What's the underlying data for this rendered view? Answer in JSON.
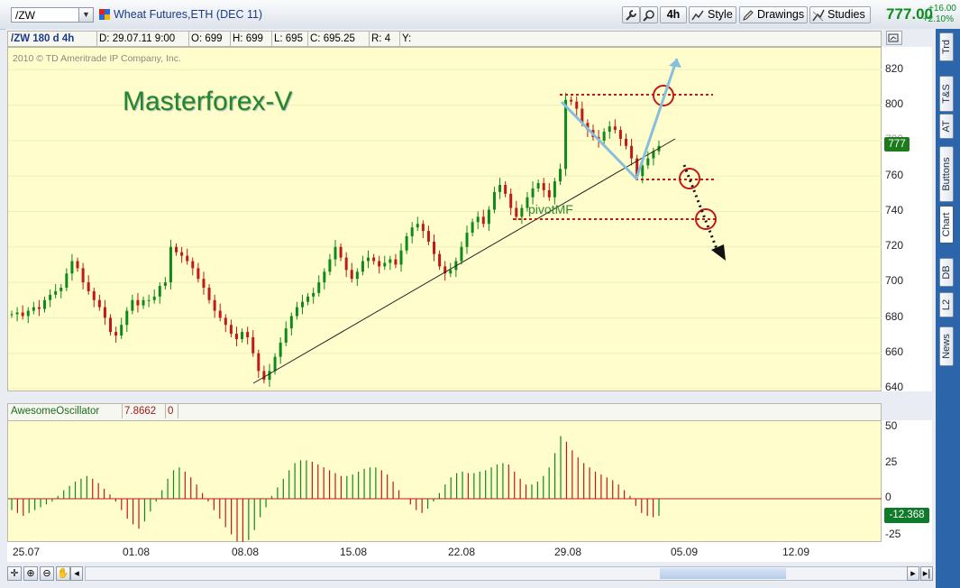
{
  "toolbar": {
    "symbol": "/ZW",
    "instrument_name": "Wheat Futures,ETH (DEC 11)",
    "timeframe_label": "4h",
    "style_label": "Style",
    "drawings_label": "Drawings",
    "studies_label": "Studies",
    "last_price": "777.00",
    "net_change": "+16.00",
    "percent_change": "+2.10%"
  },
  "side_tabs": [
    "Trd",
    "T&S",
    "AT",
    "Buttons",
    "Chart",
    "DB",
    "L2",
    "News"
  ],
  "info_bar": {
    "symbol_period": "/ZW 180 d 4h",
    "date": "D: 29.07.11 9:00",
    "open": "O: 699",
    "high": "H: 699",
    "low": "L: 695",
    "close": "C: 695.25",
    "range": "R: 4",
    "y": "Y:"
  },
  "chart": {
    "copyright": "2010 © TD Ameritrade IP Company, Inc.",
    "watermark": "Masterforex-V",
    "pivot_label": "pivotMF",
    "price_badge": "777",
    "y_ticks": [
      "820",
      "800",
      "780",
      "760",
      "740",
      "720",
      "700",
      "680",
      "660",
      "640"
    ],
    "x_ticks": [
      "25.07",
      "01.08",
      "08.08",
      "15.08",
      "22.08",
      "29.08",
      "05.09",
      "12.09"
    ]
  },
  "oscillator": {
    "name": "AwesomeOscillator",
    "value1": "7.8662",
    "value2": "0",
    "badge": "-12.368",
    "y_ticks": [
      "50",
      "25",
      "0",
      "-25"
    ]
  },
  "chart_data": {
    "type": "candlestick",
    "title": "Wheat Futures,ETH (DEC 11)",
    "ylim": [
      640,
      825
    ],
    "x_labels": [
      "25.07",
      "01.08",
      "08.08",
      "15.08",
      "22.08",
      "29.08",
      "05.09",
      "12.09"
    ],
    "closes": [
      682,
      683,
      681,
      684,
      686,
      685,
      690,
      693,
      695,
      697,
      705,
      712,
      708,
      700,
      695,
      690,
      686,
      680,
      672,
      670,
      676,
      684,
      690,
      687,
      690,
      690,
      692,
      698,
      700,
      720,
      717,
      715,
      712,
      708,
      702,
      697,
      690,
      684,
      680,
      676,
      671,
      668,
      672,
      669,
      660,
      650,
      645,
      650,
      658,
      666,
      674,
      681,
      686,
      689,
      692,
      694,
      700,
      706,
      713,
      720,
      714,
      707,
      702,
      706,
      712,
      714,
      712,
      709,
      711,
      713,
      710,
      718,
      726,
      731,
      733,
      729,
      723,
      716,
      709,
      705,
      707,
      712,
      720,
      728,
      734,
      737,
      733,
      741,
      751,
      755,
      750,
      742,
      737,
      742,
      748,
      753,
      756,
      752,
      748,
      757,
      764,
      803,
      802,
      798,
      790,
      786,
      782,
      780,
      785,
      788,
      786,
      781,
      777,
      770,
      760,
      766,
      770,
      774,
      777
    ],
    "oscillator_series": [
      -8,
      -10,
      -12,
      -10,
      -8,
      -6,
      -4,
      -2,
      2,
      6,
      9,
      12,
      14,
      16,
      14,
      11,
      7,
      3,
      -2,
      -8,
      -14,
      -18,
      -21,
      -16,
      -9,
      -2,
      6,
      14,
      20,
      22,
      19,
      15,
      10,
      4,
      -2,
      -8,
      -14,
      -20,
      -25,
      -30,
      -33,
      -29,
      -22,
      -13,
      -6,
      2,
      8,
      14,
      20,
      25,
      27,
      27,
      26,
      24,
      22,
      20,
      18,
      16,
      16,
      17,
      19,
      21,
      22,
      22,
      20,
      17,
      12,
      6,
      0,
      -4,
      -8,
      -10,
      -7,
      -2,
      4,
      10,
      15,
      18,
      19,
      18,
      18,
      19,
      20,
      22,
      24,
      25,
      24,
      19,
      14,
      10,
      10,
      12,
      16,
      22,
      32,
      44,
      40,
      34,
      29,
      25,
      22,
      19,
      17,
      15,
      13,
      10,
      6,
      2,
      -5,
      -10,
      -12,
      -13,
      -12
    ]
  }
}
